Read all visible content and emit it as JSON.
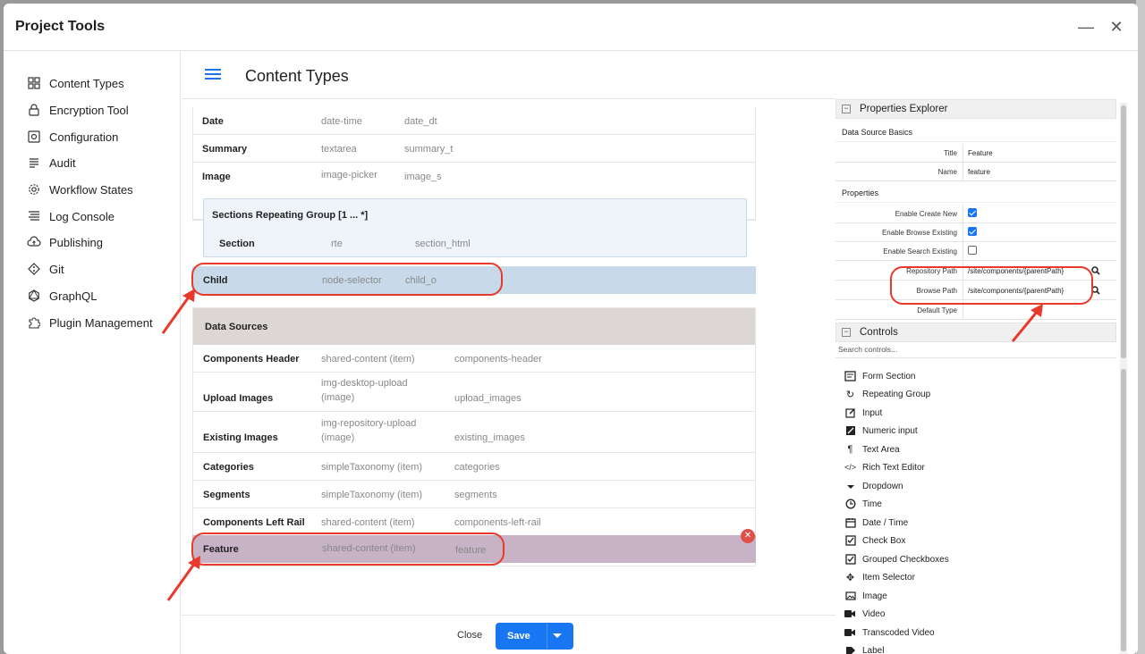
{
  "window": {
    "title": "Project Tools",
    "minimize": "—",
    "close": "✕"
  },
  "sidebar": {
    "items": [
      {
        "label": "Content Types",
        "icon": "content-types-icon"
      },
      {
        "label": "Encryption Tool",
        "icon": "lock-icon"
      },
      {
        "label": "Configuration",
        "icon": "configuration-icon"
      },
      {
        "label": "Audit",
        "icon": "audit-icon"
      },
      {
        "label": "Workflow States",
        "icon": "gear-icon"
      },
      {
        "label": "Log Console",
        "icon": "log-icon"
      },
      {
        "label": "Publishing",
        "icon": "cloud-upload-icon"
      },
      {
        "label": "Git",
        "icon": "git-icon"
      },
      {
        "label": "GraphQL",
        "icon": "graphql-icon"
      },
      {
        "label": "Plugin Management",
        "icon": "puzzle-icon"
      }
    ]
  },
  "header": {
    "title": "Content Types"
  },
  "fields": [
    {
      "name": "Date",
      "type": "date-time",
      "id": "date_dt"
    },
    {
      "name": "Summary",
      "type": "textarea",
      "id": "summary_t"
    },
    {
      "name": "Image",
      "type": "image-picker",
      "id": "image_s"
    }
  ],
  "repeating_group": {
    "title": "Sections Repeating Group [1 ... *]",
    "row": {
      "name": "Section",
      "type": "rte",
      "id": "section_html"
    }
  },
  "child": {
    "name": "Child",
    "type": "node-selector",
    "id": "child_o"
  },
  "data_sources": {
    "title": "Data Sources",
    "rows": [
      {
        "name": "Components Header",
        "type": "shared-content (item)",
        "id": "components-header"
      },
      {
        "name": "Upload Images",
        "type_line1": "img-desktop-upload",
        "type_line2": "(image)",
        "id": "upload_images"
      },
      {
        "name": "Existing Images",
        "type_line1": "img-repository-upload",
        "type_line2": "(image)",
        "id": "existing_images"
      },
      {
        "name": "Categories",
        "type": "simpleTaxonomy (item)",
        "id": "categories"
      },
      {
        "name": "Segments",
        "type": "simpleTaxonomy (item)",
        "id": "segments"
      },
      {
        "name": "Components Left Rail",
        "type": "shared-content (item)",
        "id": "components-left-rail"
      }
    ],
    "feature": {
      "name": "Feature",
      "type": "shared-content (item)",
      "id": "feature"
    }
  },
  "footer": {
    "close": "Close",
    "save": "Save"
  },
  "properties": {
    "title": "Properties Explorer",
    "basics_title": "Data Source Basics",
    "title_label": "Title",
    "title_value": "Feature",
    "name_label": "Name",
    "name_value": "feature",
    "props_title": "Properties",
    "enable_create_label": "Enable Create New",
    "enable_create": true,
    "enable_browse_label": "Enable Browse Existing",
    "enable_browse": true,
    "enable_search_label": "Enable Search Existing",
    "enable_search": false,
    "repo_path_label": "Repository Path",
    "repo_path": "/site/components/{parentPath}",
    "browse_path_label": "Browse Path",
    "browse_path": "/site/components/{parentPath}",
    "default_type_label": "Default Type",
    "default_type": ""
  },
  "controls": {
    "title": "Controls",
    "search_placeholder": "Search controls...",
    "items": [
      {
        "label": "Form Section",
        "icon": "form-section-icon"
      },
      {
        "label": "Repeating Group",
        "icon": "repeat-icon"
      },
      {
        "label": "Input",
        "icon": "input-icon"
      },
      {
        "label": "Numeric input",
        "icon": "numeric-input-icon"
      },
      {
        "label": "Text Area",
        "icon": "paragraph-icon"
      },
      {
        "label": "Rich Text Editor",
        "icon": "code-icon"
      },
      {
        "label": "Dropdown",
        "icon": "dropdown-icon"
      },
      {
        "label": "Time",
        "icon": "clock-icon"
      },
      {
        "label": "Date / Time",
        "icon": "calendar-icon"
      },
      {
        "label": "Check Box",
        "icon": "checkbox-icon"
      },
      {
        "label": "Grouped Checkboxes",
        "icon": "grouped-checkbox-icon"
      },
      {
        "label": "Item Selector",
        "icon": "item-selector-icon"
      },
      {
        "label": "Image",
        "icon": "image-icon"
      },
      {
        "label": "Video",
        "icon": "video-icon"
      },
      {
        "label": "Transcoded Video",
        "icon": "transcoded-video-icon"
      },
      {
        "label": "Label",
        "icon": "label-icon"
      }
    ]
  },
  "colors": {
    "accent": "#1876f2",
    "annotation": "#e8392a",
    "child_highlight": "#c8daea",
    "feature_highlight": "#c7b2c6"
  }
}
